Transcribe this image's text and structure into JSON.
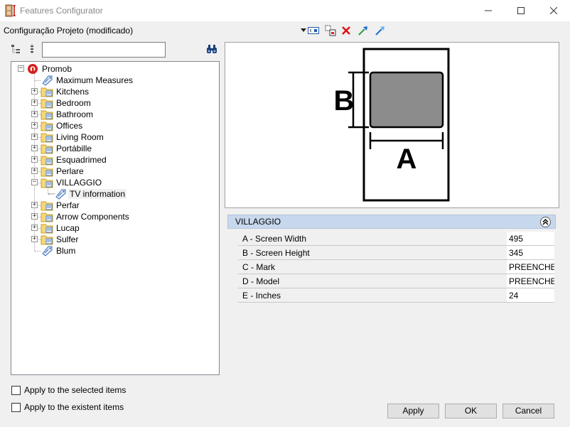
{
  "window": {
    "title": "Features Configurator"
  },
  "toolbar": {
    "configuration_label": "Configuração Projeto (modificado)"
  },
  "search": {
    "value": ""
  },
  "tree": {
    "items": [
      {
        "label": "Promob"
      },
      {
        "label": "Maximum Measures"
      },
      {
        "label": "Kitchens"
      },
      {
        "label": "Bedroom"
      },
      {
        "label": "Bathroom"
      },
      {
        "label": "Offices"
      },
      {
        "label": "Living Room"
      },
      {
        "label": "Portábille"
      },
      {
        "label": "Esquadrimed"
      },
      {
        "label": "Perlare"
      },
      {
        "label": "VILLAGGIO"
      },
      {
        "label": "TV information"
      },
      {
        "label": "Perfar"
      },
      {
        "label": "Arrow Components"
      },
      {
        "label": "Lucap"
      },
      {
        "label": "Sulfer"
      },
      {
        "label": "Blum"
      }
    ]
  },
  "preview": {
    "label_a": "A",
    "label_b": "B"
  },
  "properties": {
    "group_title": "VILLAGGIO",
    "rows": [
      {
        "name": "A -  Screen Width",
        "value": "495"
      },
      {
        "name": "B -  Screen Height",
        "value": "345"
      },
      {
        "name": "C -  Mark",
        "value": "PREENCHER"
      },
      {
        "name": "D -  Model",
        "value": "PREENCHER"
      },
      {
        "name": "E -  Inches",
        "value": "24"
      }
    ]
  },
  "options": {
    "apply_selected": "Apply to the selected items",
    "apply_existent": "Apply to the existent items"
  },
  "buttons": {
    "apply": "Apply",
    "ok": "OK",
    "cancel": "Cancel"
  }
}
